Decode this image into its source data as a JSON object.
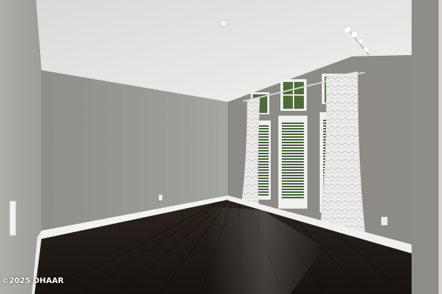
{
  "photo": {
    "watermark": "©2025 DHAAR"
  },
  "colors": {
    "ceiling": "#e6e6e4",
    "left_wall": "#a6a7a3",
    "back_wall": "#979794",
    "right_wall": "#8a8985",
    "floor": "#1f1915",
    "baseboard": "#f1f1ef",
    "curtain": "#e5e5e2"
  }
}
